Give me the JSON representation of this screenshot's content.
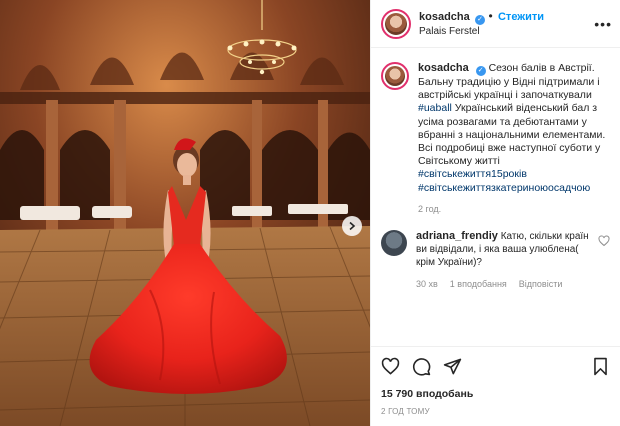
{
  "post": {
    "username": "kosadcha",
    "follow_label": "Стежити",
    "location": "Palais Ferstel",
    "more_label": "•••"
  },
  "caption": {
    "username": "kosadcha",
    "text_1": "Сезон балів в Австрії. Бальну традицію у Відні підтримали і австрійські українці і започаткували",
    "tag_1": "#uaball",
    "text_2": "Український віденський бал з усіма розвагами та дебютантами у вбранні з національними елементами. Всі подробиці вже наступної суботи у Світському житті",
    "tag_2": "#світськежиття15років",
    "tag_3": "#світськежиттязкатериноюосадчою",
    "time": "2 год."
  },
  "comment": {
    "username": "adriana_frendiy",
    "text": "Катю, скільки країн ви відвідали, і яка ваша улюблена( крім України)?",
    "time": "30 хв",
    "replies_label": "1 вподобання",
    "reply_label": "Відповісти"
  },
  "footer": {
    "likes": "15 790 вподобань",
    "posted": "2 ГОД ТОМУ"
  },
  "icons": {
    "like": "heart-icon",
    "comment": "comment-icon",
    "share": "paper-plane-icon",
    "save": "bookmark-icon",
    "next": "chevron-right-icon",
    "verified": "verified-badge-icon"
  },
  "colors": {
    "accent": "#0095f6",
    "hashtag": "#00376b",
    "muted": "#8e8e8e",
    "verified": "#3897f0",
    "dress": "#e8231b"
  }
}
